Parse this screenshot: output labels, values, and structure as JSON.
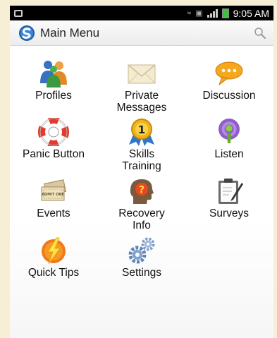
{
  "status_bar": {
    "time": "9:05 AM"
  },
  "action_bar": {
    "title": "Main Menu"
  },
  "menu": [
    {
      "label": "Profiles",
      "icon": "profiles-icon"
    },
    {
      "label": "Private\nMessages",
      "icon": "envelope-icon"
    },
    {
      "label": "Discussion",
      "icon": "speech-bubble-icon"
    },
    {
      "label": "Panic Button",
      "icon": "lifebuoy-icon"
    },
    {
      "label": "Skills\nTraining",
      "icon": "medal-icon"
    },
    {
      "label": "Listen",
      "icon": "podcast-icon"
    },
    {
      "label": "Events",
      "icon": "ticket-icon"
    },
    {
      "label": "Recovery\nInfo",
      "icon": "head-question-icon"
    },
    {
      "label": "Surveys",
      "icon": "clipboard-icon"
    },
    {
      "label": "Quick Tips",
      "icon": "lightning-icon"
    },
    {
      "label": "Settings",
      "icon": "gears-icon"
    }
  ],
  "ticket_text": "ADMIT ONE",
  "medal_number": "1",
  "head_symbol": "?",
  "colors": {
    "page_bg": "#f7eed6",
    "status_bg": "#000000",
    "app_logo": "#1f5fa8"
  }
}
